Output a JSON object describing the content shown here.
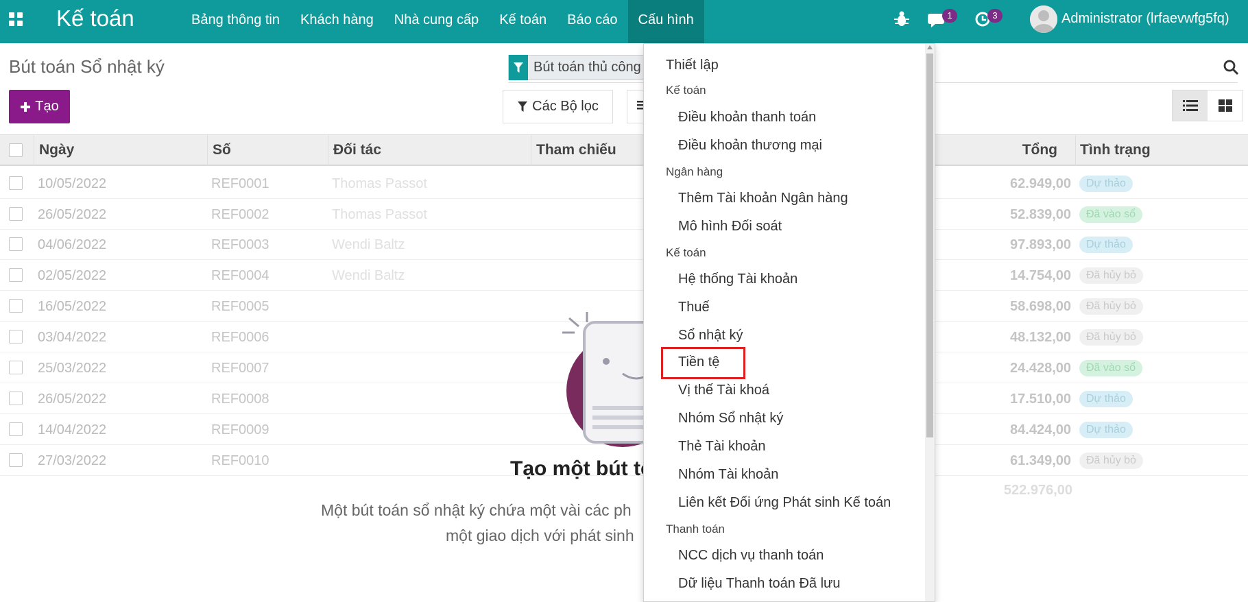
{
  "navbar": {
    "app_title": "Kế toán",
    "menu": [
      {
        "label": "Bảng thông tin"
      },
      {
        "label": "Khách hàng"
      },
      {
        "label": "Nhà cung cấp"
      },
      {
        "label": "Kế toán"
      },
      {
        "label": "Báo cáo"
      },
      {
        "label": "Cấu hình"
      }
    ],
    "messages_count": "1",
    "activities_count": "3",
    "user_name": "Administrator (lrfaevwfg5fq)"
  },
  "control_panel": {
    "breadcrumb": "Bút toán Sổ nhật ký",
    "search_facet": "Bút toán thủ công",
    "create_label": "Tạo",
    "filters_label": "Các Bộ lọc"
  },
  "table": {
    "columns": {
      "date": "Ngày",
      "number": "Số",
      "partner": "Đối tác",
      "reference": "Tham chiếu",
      "total": "Tổng",
      "status": "Tình trạng"
    },
    "rows": [
      {
        "date": "10/05/2022",
        "number": "REF0001",
        "partner": "Thomas Passot",
        "total": "62.949,00",
        "status": "Dự thảo",
        "kind": "draft"
      },
      {
        "date": "26/05/2022",
        "number": "REF0002",
        "partner": "Thomas Passot",
        "total": "52.839,00",
        "status": "Đã vào sổ",
        "kind": "posted"
      },
      {
        "date": "04/06/2022",
        "number": "REF0003",
        "partner": "Wendi Baltz",
        "total": "97.893,00",
        "status": "Dự thảo",
        "kind": "draft"
      },
      {
        "date": "02/05/2022",
        "number": "REF0004",
        "partner": "Wendi Baltz",
        "total": "14.754,00",
        "status": "Đã hủy bỏ",
        "kind": "cancel"
      },
      {
        "date": "16/05/2022",
        "number": "REF0005",
        "partner": "",
        "total": "58.698,00",
        "status": "Đã hủy bỏ",
        "kind": "cancel"
      },
      {
        "date": "03/04/2022",
        "number": "REF0006",
        "partner": "",
        "total": "48.132,00",
        "status": "Đã hủy bỏ",
        "kind": "cancel"
      },
      {
        "date": "25/03/2022",
        "number": "REF0007",
        "partner": "",
        "total": "24.428,00",
        "status": "Đã vào sổ",
        "kind": "posted"
      },
      {
        "date": "26/05/2022",
        "number": "REF0008",
        "partner": "",
        "total": "17.510,00",
        "status": "Dự thảo",
        "kind": "draft"
      },
      {
        "date": "14/04/2022",
        "number": "REF0009",
        "partner": "",
        "total": "84.424,00",
        "status": "Dự thảo",
        "kind": "draft"
      },
      {
        "date": "27/03/2022",
        "number": "REF0010",
        "partner": "",
        "total": "61.349,00",
        "status": "Đã hủy bỏ",
        "kind": "cancel"
      }
    ],
    "grand_total": "522.976,00"
  },
  "helper": {
    "title": "Tạo một bút to",
    "line1": "Một bút toán sổ nhật ký chứa một vài các ph",
    "line2": "một giao dịch với phát sinh"
  },
  "dropdown": {
    "top_item": "Thiết lập",
    "sections": [
      {
        "header": "Kế toán",
        "items": [
          "Điều khoản thanh toán",
          "Điều khoản thương mại"
        ]
      },
      {
        "header": "Ngân hàng",
        "items": [
          "Thêm Tài khoản Ngân hàng",
          "Mô hình Đối soát"
        ]
      },
      {
        "header": "Kế toán",
        "items": [
          "Hệ thống Tài khoản",
          "Thuế",
          "Sổ nhật ký",
          "Tiền tệ",
          "Vị thế Tài khoá",
          "Nhóm Sổ nhật ký",
          "Thẻ Tài khoản",
          "Nhóm Tài khoản",
          "Liên kết Đối ứng Phát sinh Kế toán"
        ]
      },
      {
        "header": "Thanh toán",
        "items": [
          "NCC dịch vụ thanh toán",
          "Dữ liệu Thanh toán Đã lưu"
        ]
      }
    ]
  },
  "colors": {
    "navbar": "#0f9b9b",
    "create_button": "#8a1a8a",
    "highlight": "#e02020"
  }
}
